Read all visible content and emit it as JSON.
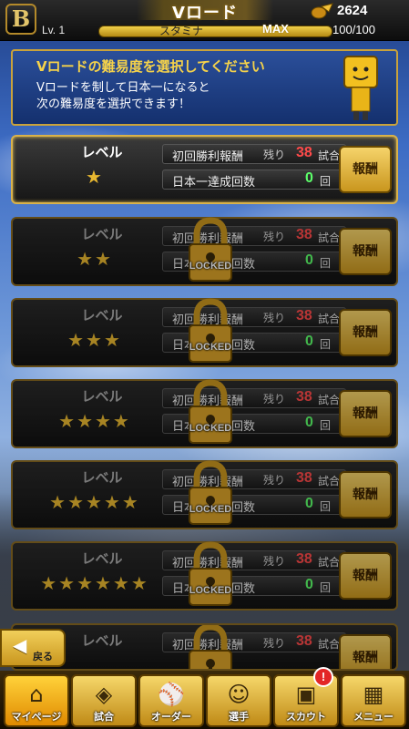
{
  "header": {
    "logo": "B",
    "title": "Vロード",
    "coins": "2624",
    "level": "Lv. 1",
    "stamina_label": "スタミナ",
    "stamina_max": "MAX",
    "stamina_value": "100/100",
    "stamina_fraction": 1.0
  },
  "info": {
    "title": "Vロードの難易度を選択してください",
    "line1": "Vロードを制して日本一になると",
    "line2": "次の難易度を選択できます！"
  },
  "levels": [
    {
      "label": "レベル",
      "stars": "★",
      "wins_label": "初回勝利報酬",
      "remaining_label": "残り",
      "remaining": "38",
      "remaining_unit": "試合",
      "champ_label": "日本一達成回数",
      "champ_count": "0",
      "champ_unit": "回",
      "reward": "報酬",
      "locked": false,
      "lock_text": ""
    },
    {
      "label": "レベル",
      "stars": "★★",
      "wins_label": "初回勝利報酬",
      "remaining_label": "残り",
      "remaining": "38",
      "remaining_unit": "試合",
      "champ_label": "日本一達成回数",
      "champ_count": "0",
      "champ_unit": "回",
      "reward": "報酬",
      "locked": true,
      "lock_text": "LOCKED"
    },
    {
      "label": "レベル",
      "stars": "★★★",
      "wins_label": "初回勝利報酬",
      "remaining_label": "残り",
      "remaining": "38",
      "remaining_unit": "試合",
      "champ_label": "日本一達成回数",
      "champ_count": "0",
      "champ_unit": "回",
      "reward": "報酬",
      "locked": true,
      "lock_text": "LOCKED"
    },
    {
      "label": "レベル",
      "stars": "★★★★",
      "wins_label": "初回勝利報酬",
      "remaining_label": "残り",
      "remaining": "38",
      "remaining_unit": "試合",
      "champ_label": "日本一達成回数",
      "champ_count": "0",
      "champ_unit": "回",
      "reward": "報酬",
      "locked": true,
      "lock_text": "LOCKED"
    },
    {
      "label": "レベル",
      "stars": "★★★★★",
      "wins_label": "初回勝利報酬",
      "remaining_label": "残り",
      "remaining": "38",
      "remaining_unit": "試合",
      "champ_label": "日本一達成回数",
      "champ_count": "0",
      "champ_unit": "回",
      "reward": "報酬",
      "locked": true,
      "lock_text": "LOCKED"
    },
    {
      "label": "レベル",
      "stars": "★★★★★★",
      "wins_label": "初回勝利報酬",
      "remaining_label": "残り",
      "remaining": "38",
      "remaining_unit": "試合",
      "champ_label": "日本一達成回数",
      "champ_count": "0",
      "champ_unit": "回",
      "reward": "報酬",
      "locked": true,
      "lock_text": "LOCKED"
    },
    {
      "label": "レベル",
      "stars": "",
      "wins_label": "初回勝利報酬",
      "remaining_label": "残り",
      "remaining": "38",
      "remaining_unit": "試合",
      "champ_label": "",
      "champ_count": "",
      "champ_unit": "",
      "reward": "報酬",
      "locked": true,
      "lock_text": ""
    }
  ],
  "back_label": "戻る",
  "nav": [
    {
      "label": "マイページ",
      "icon": "home-icon"
    },
    {
      "label": "試合",
      "icon": "baseball-field-icon"
    },
    {
      "label": "オーダー",
      "icon": "lineup-icon"
    },
    {
      "label": "選手",
      "icon": "player-icon"
    },
    {
      "label": "スカウト",
      "icon": "scout-card-icon"
    },
    {
      "label": "メニュー",
      "icon": "menu-mascot-icon"
    }
  ],
  "scout_badge": "!",
  "colors": {
    "accent": "#f5d24a",
    "remaining": "#ff4a4a",
    "count": "#5cff6a",
    "gold": "#c9961e"
  }
}
